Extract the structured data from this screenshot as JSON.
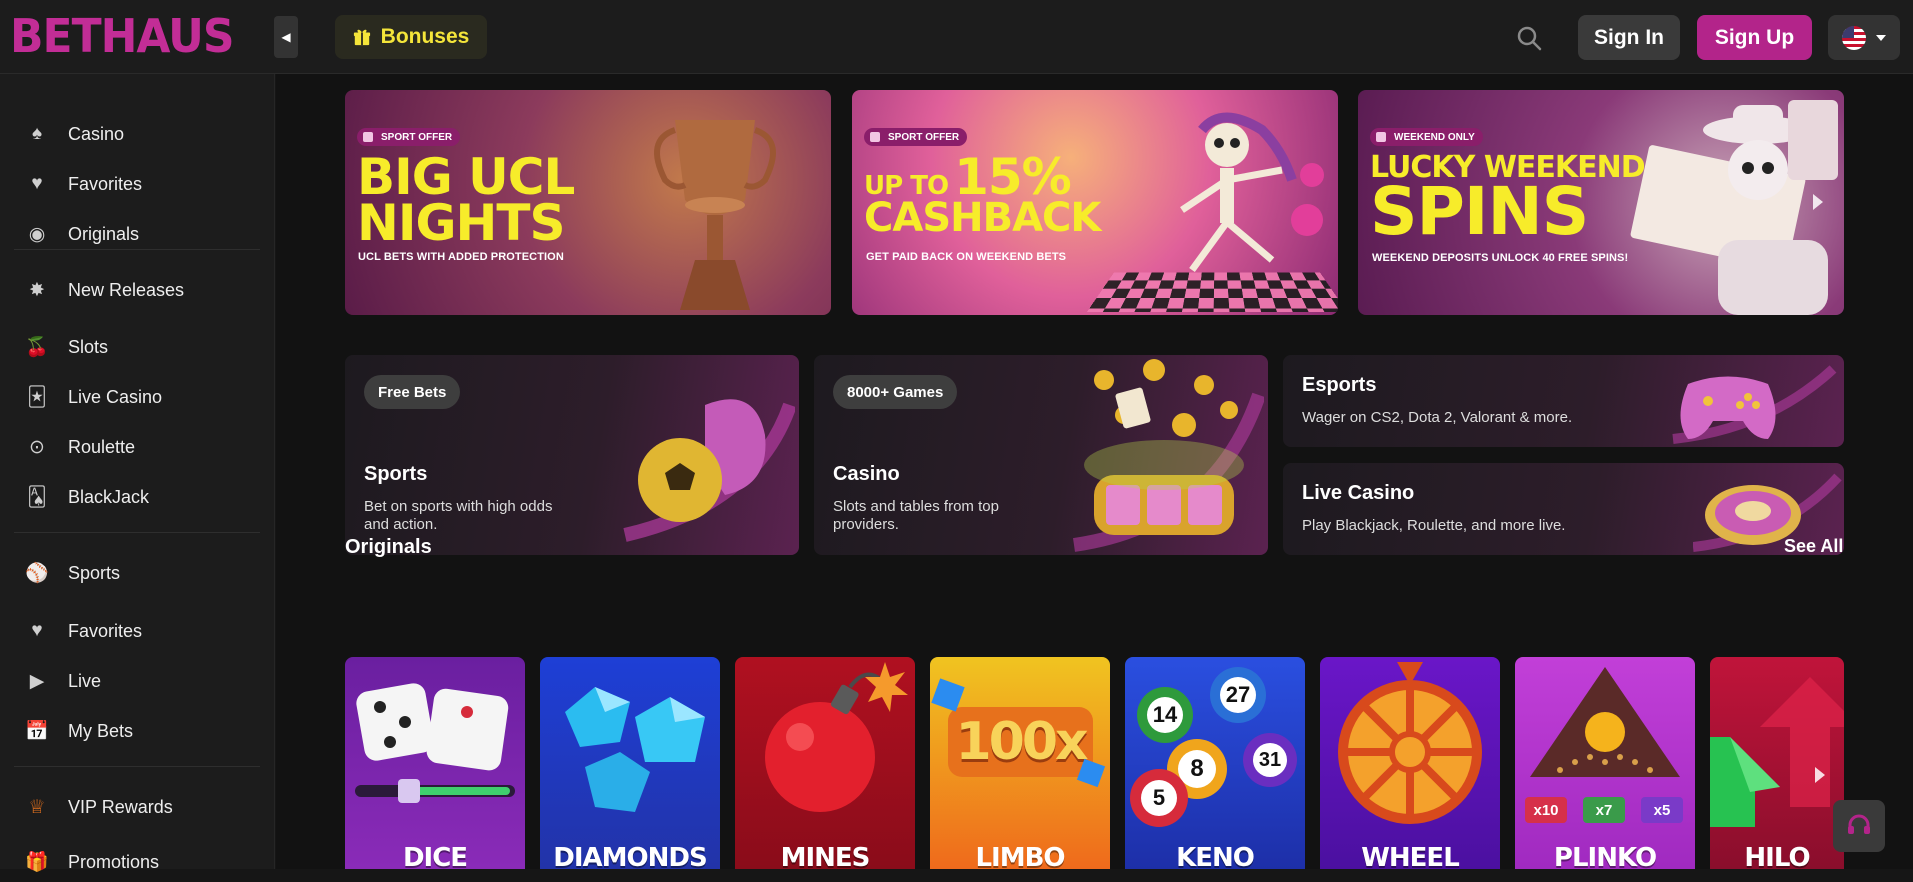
{
  "brand": {
    "logo_text": "BETHAUS",
    "accent": "#b3248a",
    "highlight": "#f4e53a"
  },
  "header": {
    "bonuses_label": "Bonuses",
    "signin_label": "Sign In",
    "signup_label": "Sign Up",
    "search_icon": "search-icon",
    "language_flag": "us-flag-icon"
  },
  "sidebar": {
    "items": [
      {
        "label": "Casino",
        "icon": "spade-icon"
      },
      {
        "label": "Favorites",
        "icon": "heart-icon"
      },
      {
        "label": "Originals",
        "icon": "originals-icon"
      },
      {
        "label": "New Releases",
        "icon": "new-badge-icon"
      },
      {
        "label": "Slots",
        "icon": "cherry-icon"
      },
      {
        "label": "Live Casino",
        "icon": "cards-icon"
      },
      {
        "label": "Roulette",
        "icon": "roulette-icon"
      },
      {
        "label": "BlackJack",
        "icon": "blackjack-icon"
      },
      {
        "label": "Sports",
        "icon": "basketball-icon"
      },
      {
        "label": "Favorites",
        "icon": "heart-icon"
      },
      {
        "label": "Live",
        "icon": "play-icon"
      },
      {
        "label": "My Bets",
        "icon": "calendar-icon"
      },
      {
        "label": "VIP Rewards",
        "icon": "crown-icon"
      },
      {
        "label": "Promotions",
        "icon": "gift-icon"
      }
    ]
  },
  "banners": [
    {
      "tag": "SPORT OFFER",
      "line1": "BIG UCL",
      "line2": "NIGHTS",
      "sub": "UCL BETS WITH ADDED PROTECTION"
    },
    {
      "tag": "SPORT OFFER",
      "line1": "UP TO",
      "line1b": "15%",
      "line2": "CASHBACK",
      "sub": "GET PAID BACK ON WEEKEND BETS"
    },
    {
      "tag": "WEEKEND ONLY",
      "line1": "LUCKY WEEKEND",
      "line2": "SPINS",
      "sub": "WEEKEND DEPOSITS UNLOCK 40 FREE SPINS!"
    }
  ],
  "cards": {
    "sports": {
      "pill": "Free Bets",
      "title": "Sports",
      "desc": "Bet on sports with high odds and action."
    },
    "casino": {
      "pill": "8000+ Games",
      "title": "Casino",
      "desc": "Slots and tables from top providers."
    },
    "esports": {
      "title": "Esports",
      "desc": "Wager on CS2, Dota 2, Valorant & more."
    },
    "live_casino": {
      "title": "Live Casino",
      "desc": "Play Blackjack, Roulette, and more live."
    }
  },
  "originals": {
    "title": "Originals",
    "see_all": "See All",
    "games": [
      "DICE",
      "DIAMONDS",
      "MINES",
      "LIMBO",
      "KENO",
      "WHEEL",
      "PLINKO",
      "HILO"
    ],
    "limbo_multiplier": "100x",
    "keno_balls": [
      "14",
      "27",
      "8",
      "31",
      "5"
    ],
    "plinko_multipliers": [
      "x10",
      "x7",
      "x5"
    ]
  }
}
